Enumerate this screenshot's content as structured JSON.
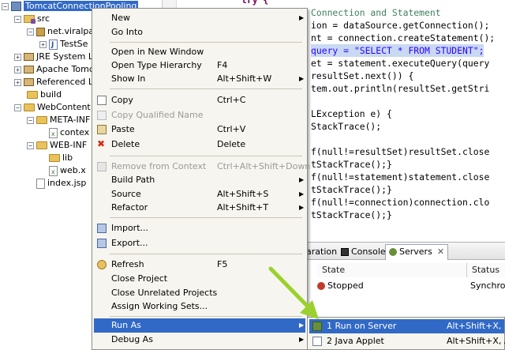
{
  "tree": {
    "items": [
      {
        "label": "TomcatConnectionPooling"
      },
      {
        "label": "src"
      },
      {
        "label": "net.viralpa"
      },
      {
        "label": "TestSe"
      },
      {
        "label": "JRE System Lib"
      },
      {
        "label": "Apache Tomca"
      },
      {
        "label": "Referenced Lib"
      },
      {
        "label": "build"
      },
      {
        "label": "WebContent"
      },
      {
        "label": "META-INF"
      },
      {
        "label": "contex"
      },
      {
        "label": "WEB-INF"
      },
      {
        "label": "lib"
      },
      {
        "label": "web.x"
      },
      {
        "label": "index.jsp"
      }
    ]
  },
  "editor": {
    "lines": [
      {
        "t": "try {"
      },
      {
        "t": "Connection and Statement"
      },
      {
        "t": "ion = dataSource.getConnection();"
      },
      {
        "t": "nt = connection.createStatement();"
      },
      {
        "t": "query = \"SELECT * FROM STUDENT\";"
      },
      {
        "t": "et = statement.executeQuery(query"
      },
      {
        "t": "resultSet.next()) {"
      },
      {
        "t": "tem.out.println(resultSet.getStri"
      },
      {
        "t": "LException e) {"
      },
      {
        "t": "StackTrace();"
      },
      {
        "t": "f(null!=resultSet)resultSet.close"
      },
      {
        "t": "tStackTrace();}"
      },
      {
        "t": "f(null!=statement)statement.close"
      },
      {
        "t": "tStackTrace();}"
      },
      {
        "t": "f(null!=connection)connection.clo"
      },
      {
        "t": "tStackTrace();}"
      }
    ]
  },
  "views": {
    "tabs": [
      {
        "label": "aration"
      },
      {
        "label": "Console"
      },
      {
        "label": "Servers"
      }
    ],
    "columns": [
      "State",
      "Status"
    ],
    "row": {
      "state": "Stopped",
      "status": "Synchroni"
    },
    "left_stub": "t"
  },
  "context_menu": {
    "items": [
      {
        "label": "New",
        "key": "",
        "submenu": true
      },
      {
        "label": "Go Into",
        "key": ""
      },
      {
        "label": "Open in New Window",
        "key": ""
      },
      {
        "label": "Open Type Hierarchy",
        "key": "F4"
      },
      {
        "label": "Show In",
        "key": "Alt+Shift+W",
        "submenu": true
      },
      {
        "label": "Copy",
        "key": "Ctrl+C"
      },
      {
        "label": "Copy Qualified Name",
        "key": ""
      },
      {
        "label": "Paste",
        "key": "Ctrl+V"
      },
      {
        "label": "Delete",
        "key": "Delete"
      },
      {
        "label": "Remove from Context",
        "key": "Ctrl+Alt+Shift+Down"
      },
      {
        "label": "Build Path",
        "key": "",
        "submenu": true
      },
      {
        "label": "Source",
        "key": "Alt+Shift+S",
        "submenu": true
      },
      {
        "label": "Refactor",
        "key": "Alt+Shift+T",
        "submenu": true
      },
      {
        "label": "Import...",
        "key": ""
      },
      {
        "label": "Export...",
        "key": ""
      },
      {
        "label": "Refresh",
        "key": "F5"
      },
      {
        "label": "Close Project",
        "key": ""
      },
      {
        "label": "Close Unrelated Projects",
        "key": ""
      },
      {
        "label": "Assign Working Sets...",
        "key": ""
      },
      {
        "label": "Run As",
        "key": "",
        "submenu": true
      },
      {
        "label": "Debug As",
        "key": "",
        "submenu": true
      }
    ]
  },
  "run_as_menu": {
    "items": [
      {
        "label": "1 Run on Server",
        "key": "Alt+Shift+X, R"
      },
      {
        "label": "2 Java Applet",
        "key": "Alt+Shift+X, A"
      }
    ]
  },
  "colors": {
    "selection": "#3169c6",
    "menu_bg": "#f7f5ef",
    "annotation_arrow": "#9bd12e",
    "keyword": "#7f0055",
    "string": "#2a00ff"
  },
  "icons": {
    "submenu_arrow": "▶",
    "expand": "+",
    "collapse": "−"
  }
}
